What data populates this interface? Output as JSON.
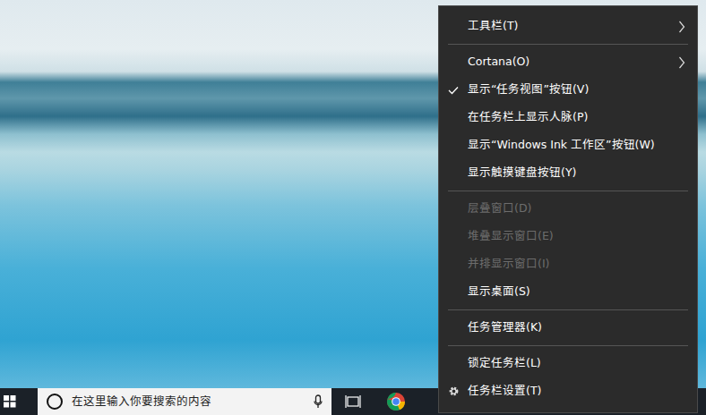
{
  "taskbar": {
    "search": {
      "placeholder": "在这里输入你要搜索的内容"
    }
  },
  "context_menu": {
    "items": [
      {
        "kind": "submenu",
        "label": "工具栏(T)",
        "checked": false,
        "disabled": false
      },
      {
        "kind": "separator"
      },
      {
        "kind": "submenu",
        "label": "Cortana(O)",
        "checked": false,
        "disabled": false
      },
      {
        "kind": "command",
        "label": "显示“任务视图”按钮(V)",
        "checked": true,
        "disabled": false
      },
      {
        "kind": "command",
        "label": "在任务栏上显示人脉(P)",
        "checked": false,
        "disabled": false
      },
      {
        "kind": "command",
        "label": "显示“Windows Ink 工作区”按钮(W)",
        "checked": false,
        "disabled": false
      },
      {
        "kind": "command",
        "label": "显示触摸键盘按钮(Y)",
        "checked": false,
        "disabled": false
      },
      {
        "kind": "separator"
      },
      {
        "kind": "command",
        "label": "层叠窗口(D)",
        "checked": false,
        "disabled": true
      },
      {
        "kind": "command",
        "label": "堆叠显示窗口(E)",
        "checked": false,
        "disabled": true
      },
      {
        "kind": "command",
        "label": "并排显示窗口(I)",
        "checked": false,
        "disabled": true
      },
      {
        "kind": "command",
        "label": "显示桌面(S)",
        "checked": false,
        "disabled": false
      },
      {
        "kind": "separator"
      },
      {
        "kind": "command",
        "label": "任务管理器(K)",
        "checked": false,
        "disabled": false
      },
      {
        "kind": "separator"
      },
      {
        "kind": "command",
        "label": "锁定任务栏(L)",
        "checked": false,
        "disabled": false
      },
      {
        "kind": "settings",
        "label": "任务栏设置(T)",
        "checked": false,
        "disabled": false
      }
    ]
  }
}
